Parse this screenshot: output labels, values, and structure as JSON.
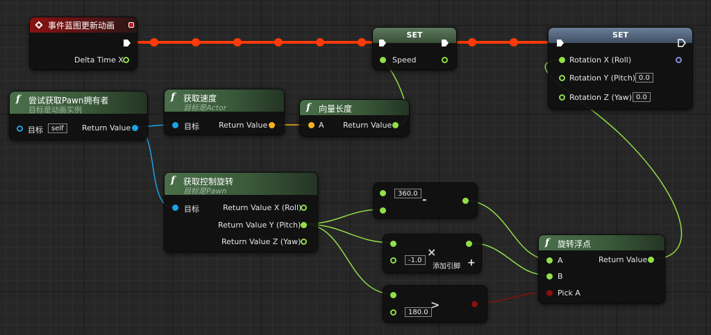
{
  "event_node": {
    "title": "事件蓝图更新动画",
    "delta_label": "Delta Time X"
  },
  "set_speed": {
    "title": "SET",
    "speed_label": "Speed"
  },
  "set_rotation": {
    "title": "SET",
    "roll_label": "Rotation X (Roll)",
    "pitch_label": "Rotation Y (Pitch)",
    "pitch_value": "0.0",
    "yaw_label": "Rotation Z (Yaw)",
    "yaw_value": "0.0"
  },
  "try_get_pawn": {
    "title": "尝试获取Pawn拥有者",
    "subtitle": "目标是动画实例",
    "target_label": "目标",
    "target_value": "self",
    "return_label": "Return Value"
  },
  "get_velocity": {
    "title": "获取速度",
    "subtitle": "目标是Actor",
    "target_label": "目标",
    "return_label": "Return Value"
  },
  "vector_length": {
    "title": "向量长度",
    "a_label": "A",
    "return_label": "Return Value"
  },
  "get_control_rotation": {
    "title": "获取控制旋转",
    "subtitle": "目标是Pawn",
    "target_label": "目标",
    "x_label": "Return Value X (Roll)",
    "y_label": "Return Value Y (Pitch)",
    "z_label": "Return Value Z (Yaw)"
  },
  "subtract_node": {
    "value": "360.0",
    "op": "-"
  },
  "multiply_node": {
    "value": "-1.0",
    "op": "×",
    "add_pin_label": "添加引脚",
    "add_icon": "+"
  },
  "compare_node": {
    "value": "180.0",
    "op": ">"
  },
  "select_float": {
    "title": "旋转浮点",
    "a_label": "A",
    "b_label": "B",
    "pick_label": "Pick A",
    "return_label": "Return Value"
  },
  "colors": {
    "exec_wire": "#ff3a06",
    "float_wire": "#92e047",
    "object_wire": "#1ca3e6",
    "vector_wire": "#f6b21c",
    "bool_wire": "#8c0e0e"
  }
}
